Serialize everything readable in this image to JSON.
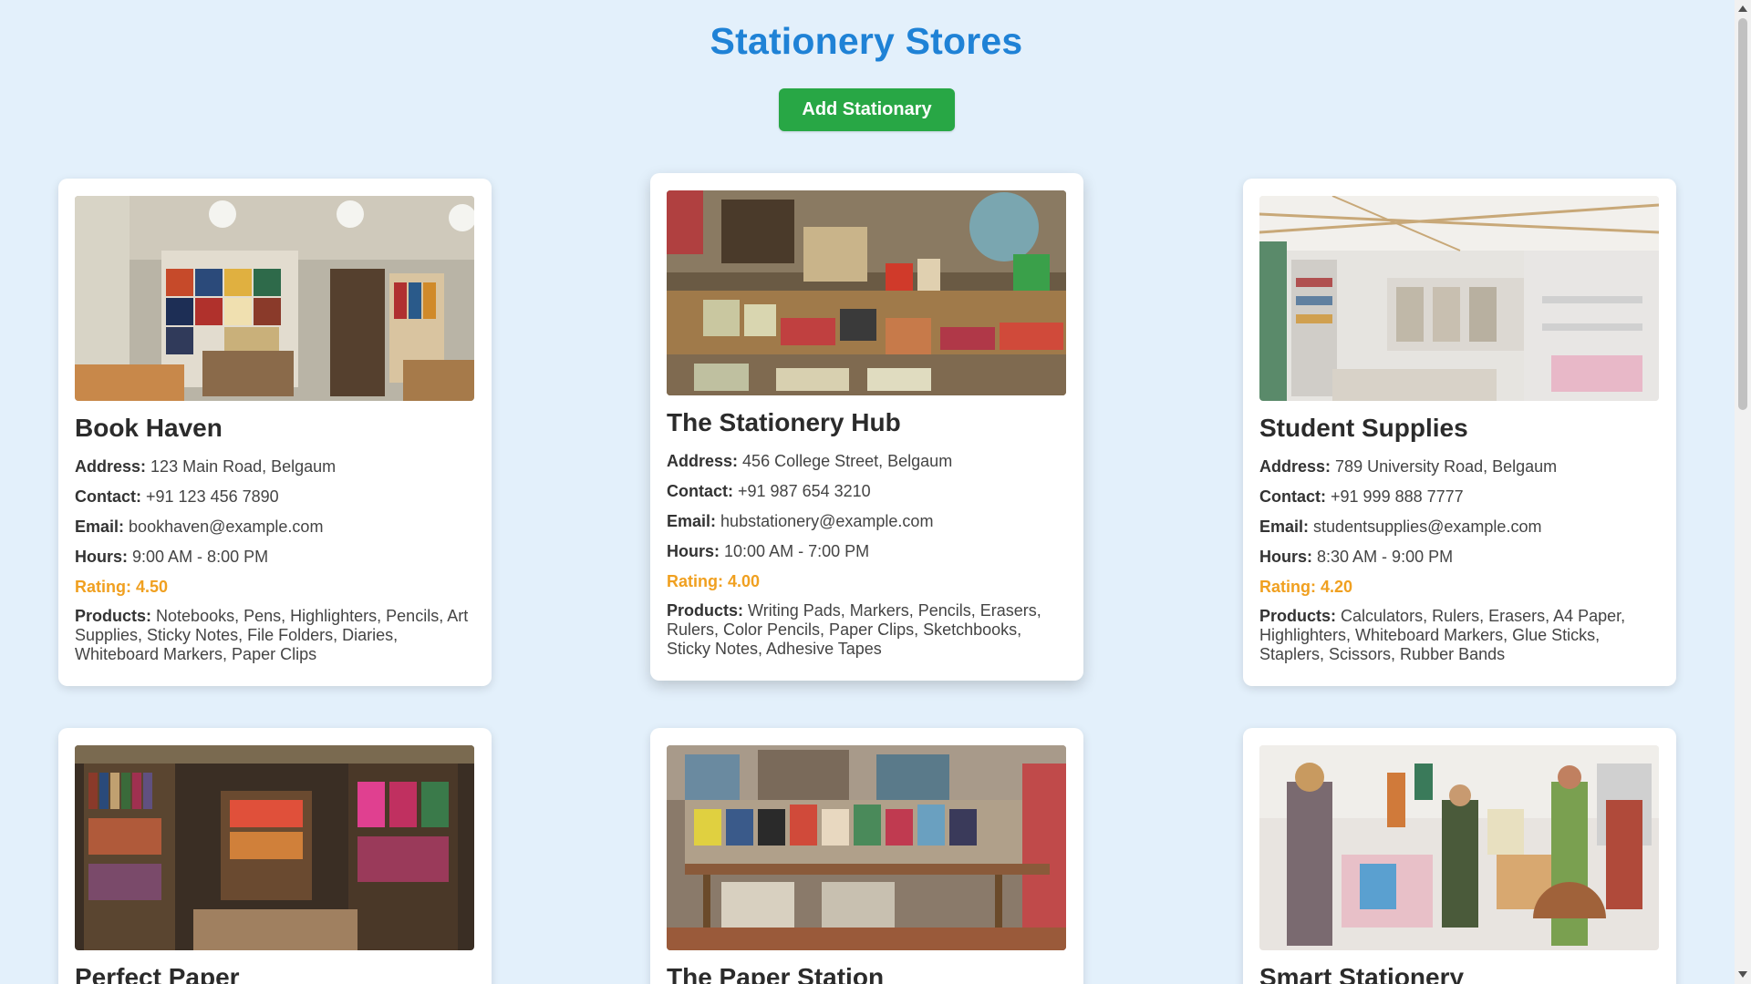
{
  "page": {
    "title": "Stationery Stores",
    "add_button_label": "Add Stationary"
  },
  "stores": [
    {
      "name": "Book Haven",
      "address_label": "Address:",
      "address": "123 Main Road, Belgaum",
      "contact_label": "Contact:",
      "contact": "+91 123 456 7890",
      "email_label": "Email:",
      "email": "bookhaven@example.com",
      "hours_label": "Hours:",
      "hours": "9:00 AM - 8:00 PM",
      "rating": "Rating: 4.50",
      "products_label": "Products:",
      "products": "Notebooks, Pens, Highlighters, Pencils, Art Supplies, Sticky Notes, File Folders, Diaries, Whiteboard Markers, Paper Clips"
    },
    {
      "name": "The Stationery Hub",
      "address_label": "Address:",
      "address": "456 College Street, Belgaum",
      "contact_label": "Contact:",
      "contact": "+91 987 654 3210",
      "email_label": "Email:",
      "email": "hubstationery@example.com",
      "hours_label": "Hours:",
      "hours": "10:00 AM - 7:00 PM",
      "rating": "Rating: 4.00",
      "products_label": "Products:",
      "products": "Writing Pads, Markers, Pencils, Erasers, Rulers, Color Pencils, Paper Clips, Sketchbooks, Sticky Notes, Adhesive Tapes"
    },
    {
      "name": "Student Supplies",
      "address_label": "Address:",
      "address": "789 University Road, Belgaum",
      "contact_label": "Contact:",
      "contact": "+91 999 888 7777",
      "email_label": "Email:",
      "email": "studentsupplies@example.com",
      "hours_label": "Hours:",
      "hours": "8:30 AM - 9:00 PM",
      "rating": "Rating: 4.20",
      "products_label": "Products:",
      "products": "Calculators, Rulers, Erasers, A4 Paper, Highlighters, Whiteboard Markers, Glue Sticks, Staplers, Scissors, Rubber Bands"
    },
    {
      "name": "Perfect Paper"
    },
    {
      "name": "The Paper Station"
    },
    {
      "name": "Smart Stationery"
    }
  ]
}
